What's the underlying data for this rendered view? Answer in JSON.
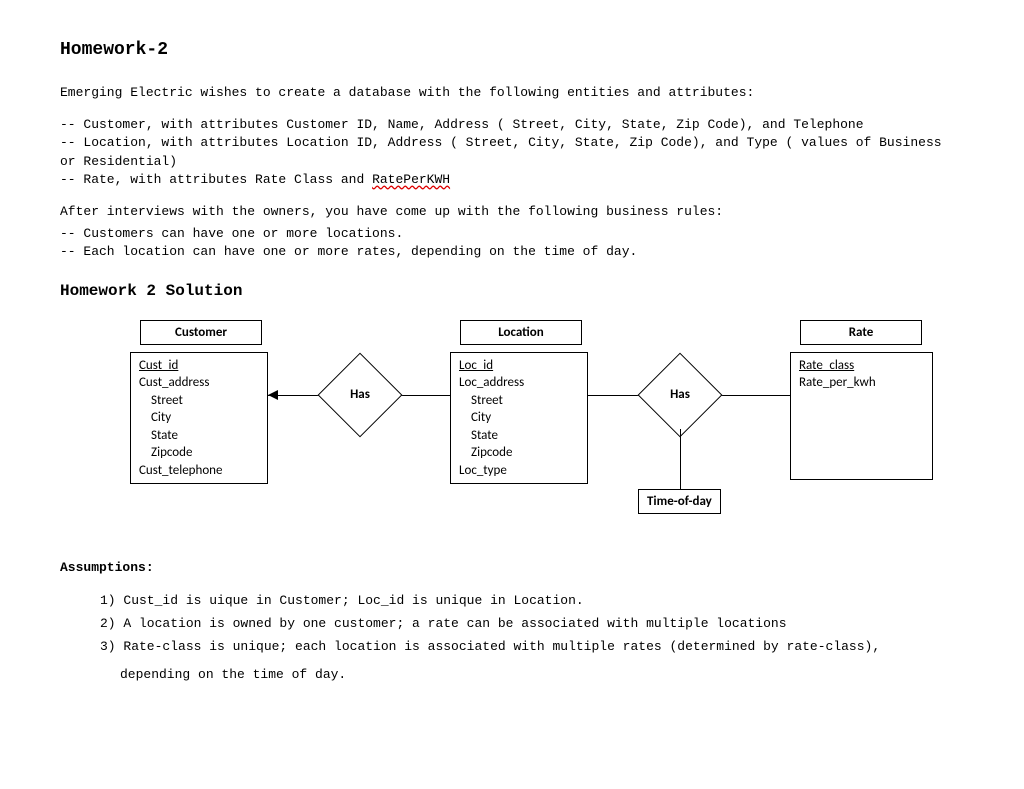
{
  "title": "Homework-2",
  "intro": "Emerging Electric wishes to create a database with the following entities and attributes:",
  "bullets": {
    "b1": "-- Customer, with attributes Customer ID, Name, Address ( Street, City, State, Zip Code), and Telephone",
    "b2": "-- Location, with attributes Location ID, Address ( Street, City, State, Zip Code), and Type ( values of Business or Residential)",
    "b3a": "-- Rate, with attributes Rate Class and ",
    "b3b": "RatePerKWH"
  },
  "rules_intro": "After interviews with the owners, you have come up with the following business rules:",
  "rules": {
    "r1": "-- Customers can have one or more locations.",
    "r2": "-- Each location can have one or more rates, depending on the time of day."
  },
  "solution_title": "Homework 2 Solution",
  "entities": {
    "customer": {
      "title": "Customer",
      "a1": "Cust_id",
      "a2": "Cust_address",
      "a3": "Street",
      "a4": "City",
      "a5": "State",
      "a6": "Zipcode",
      "a7": "Cust_telephone"
    },
    "location": {
      "title": "Location",
      "a1": "Loc_id",
      "a2": "Loc_address",
      "a3": "Street",
      "a4": "City",
      "a5": "State",
      "a6": "Zipcode",
      "a7": "Loc_type"
    },
    "rate": {
      "title": "Rate",
      "a1": "Rate_class",
      "a2": "Rate_per_kwh"
    }
  },
  "rel": {
    "has1": "Has",
    "has2": "Has",
    "attr": "Time-of-day"
  },
  "assumptions_title": "Assumptions:",
  "assumptions": {
    "l1": "1) Cust_id is uique in Customer; Loc_id is unique in Location.",
    "l2": "2) A location is owned by one customer; a rate can be associated with multiple locations",
    "l3": "3) Rate-class is unique; each location is associated with multiple rates (determined by rate-class),",
    "l4": "depending on the time of day."
  }
}
